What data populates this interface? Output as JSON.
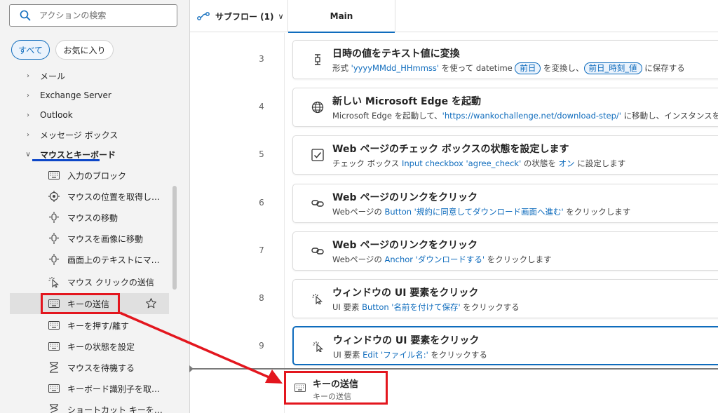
{
  "search": {
    "placeholder": "アクションの検索"
  },
  "filters": {
    "all": "すべて",
    "favorites": "お気に入り"
  },
  "tree": {
    "groups": [
      {
        "label": "メール"
      },
      {
        "label": "Exchange Server"
      },
      {
        "label": "Outlook"
      },
      {
        "label": "メッセージ ボックス"
      },
      {
        "label": "マウスとキーボード"
      }
    ],
    "actions": [
      {
        "label": "入力のブロック",
        "icon": "keyboard-icon"
      },
      {
        "label": "マウスの位置を取得します",
        "icon": "mouse-position-icon"
      },
      {
        "label": "マウスの移動",
        "icon": "mouse-move-icon"
      },
      {
        "label": "マウスを画像に移動",
        "icon": "mouse-move-icon"
      },
      {
        "label": "画面上のテキストにマウ...",
        "icon": "mouse-move-icon"
      },
      {
        "label": "マウス クリックの送信",
        "icon": "mouse-click-icon"
      },
      {
        "label": "キーの送信",
        "icon": "keyboard-icon"
      },
      {
        "label": "キーを押す/離す",
        "icon": "keyboard-icon"
      },
      {
        "label": "キーの状態を設定",
        "icon": "keyboard-icon"
      },
      {
        "label": "マウスを待機する",
        "icon": "hourglass-icon"
      },
      {
        "label": "キーボード識別子を取得...",
        "icon": "keyboard-icon"
      },
      {
        "label": "ショートカット キーを待機",
        "icon": "hourglass-icon"
      }
    ]
  },
  "tabs": {
    "subflow": "サブフロー (1)",
    "main": "Main"
  },
  "steps": [
    {
      "num": "3",
      "title": "日時の値をテキスト値に変換"
    },
    {
      "num": "4",
      "title": "新しい Microsoft Edge を起動"
    },
    {
      "num": "5",
      "title": "Web ページのチェック ボックスの状態を設定します"
    },
    {
      "num": "6",
      "title": "Web ページのリンクをクリック"
    },
    {
      "num": "7",
      "title": "Web ページのリンクをクリック"
    },
    {
      "num": "8",
      "title": "ウィンドウの UI 要素をクリック"
    },
    {
      "num": "9",
      "title": "ウィンドウの UI 要素をクリック"
    }
  ],
  "desc": {
    "s3": {
      "a": "形式 ",
      "fmt": "'yyyyMMdd_HHmmss'",
      "b": " を使って datetime ",
      "chip1": "前日",
      "c": " を変換し、",
      "chip2": "前日_時刻_値",
      "d": " に保存する"
    },
    "s4": {
      "a": "Microsoft Edge を起動して、",
      "url": "'https://wankochallenge.net/download-step/'",
      "b": " に移動し、インスタンスを"
    },
    "s5": {
      "a": "チェック ボックス ",
      "el": "Input checkbox 'agree_check'",
      "b": " の状態を ",
      "on": "オン",
      "c": " に設定します"
    },
    "s6": {
      "a": "Webページの ",
      "el": "Button '規約に同意してダウンロード画面へ進む'",
      "b": " をクリックします"
    },
    "s7": {
      "a": "Webページの ",
      "el": "Anchor 'ダウンロードする'",
      "b": " をクリックします"
    },
    "s8": {
      "a": "UI 要素 ",
      "el": "Button '名前を付けて保存'",
      "b": " をクリックする"
    },
    "s9": {
      "a": "UI 要素 ",
      "el": "Edit 'ファイル名:'",
      "b": " をクリックする"
    }
  },
  "dragged": {
    "title": "キーの送信",
    "subtitle": "キーの送信"
  },
  "colors": {
    "accent": "#0f6cbd",
    "annotation": "#e3161e",
    "underline": "#0c46c8"
  }
}
